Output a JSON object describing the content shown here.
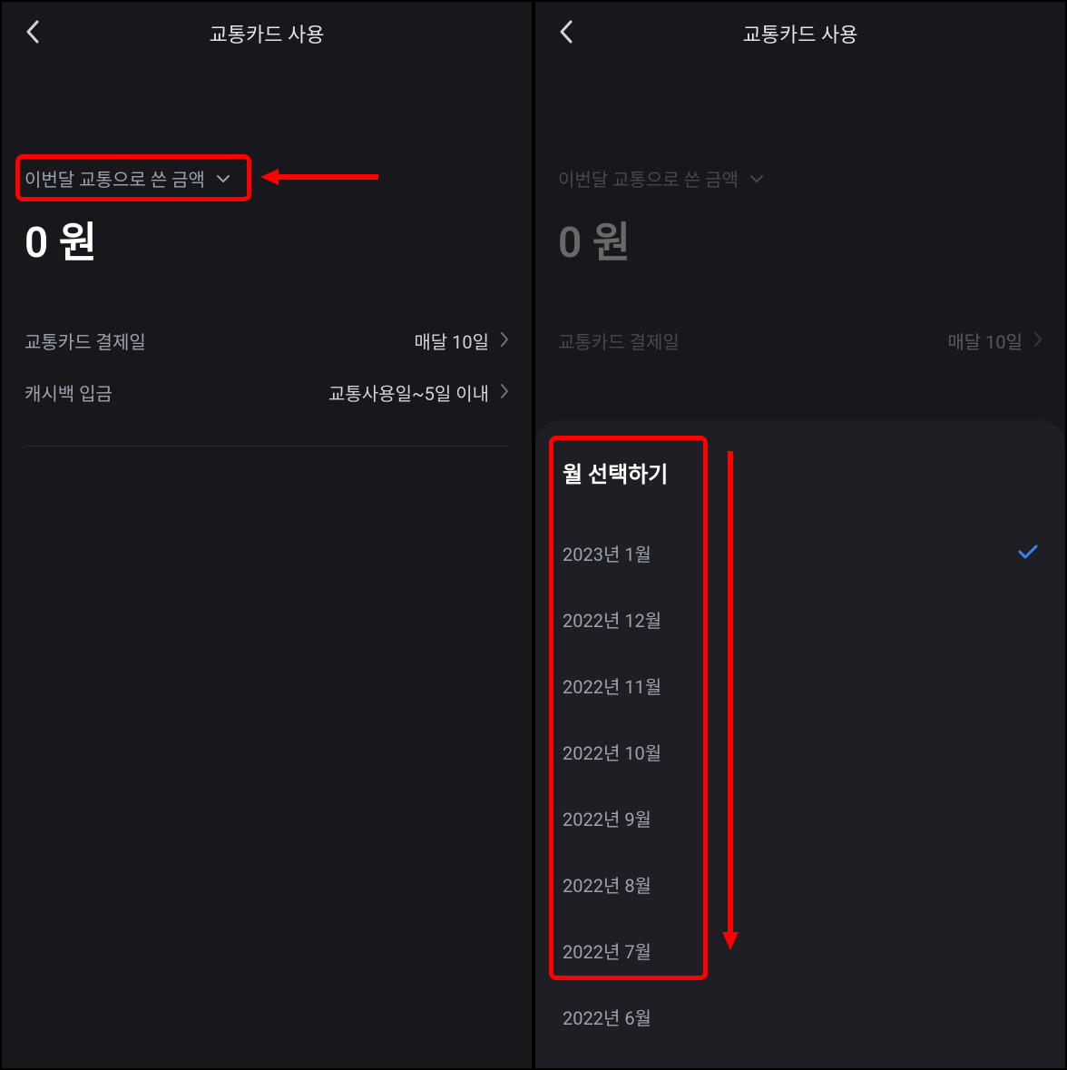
{
  "screen1": {
    "header": {
      "title": "교통카드 사용"
    },
    "dropdown": {
      "label": "이번달 교통으로 쓴 금액"
    },
    "amount": "0 원",
    "info": [
      {
        "label": "교통카드 결제일",
        "value": "매달 10일"
      },
      {
        "label": "캐시백 입금",
        "value": "교통사용일~5일 이내"
      }
    ]
  },
  "screen2": {
    "header": {
      "title": "교통카드 사용"
    },
    "dropdown": {
      "label": "이번달 교통으로 쓴 금액"
    },
    "amount": "0 원",
    "info": [
      {
        "label": "교통카드 결제일",
        "value": "매달 10일"
      }
    ],
    "sheet": {
      "title": "월 선택하기",
      "months": [
        "2023년 1월",
        "2022년 12월",
        "2022년 11월",
        "2022년 10월",
        "2022년 9월",
        "2022년 8월",
        "2022년 7월",
        "2022년 6월"
      ],
      "selected_index": 0
    }
  }
}
